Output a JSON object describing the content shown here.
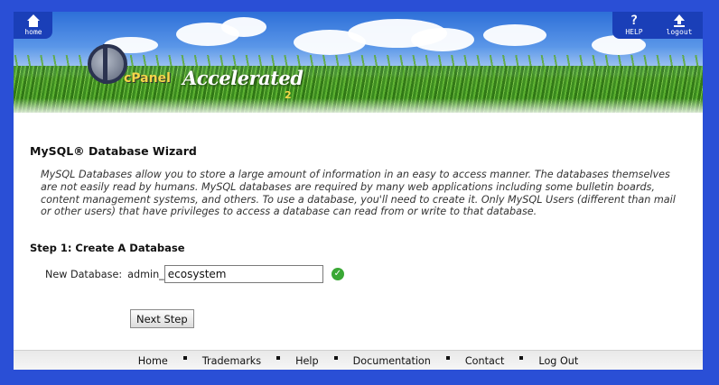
{
  "header": {
    "home_label": "home",
    "help_label": "HELP",
    "logout_label": "logout",
    "logo_text": "cPanel",
    "logo_accent": "Accelerated",
    "logo_version": "2"
  },
  "page": {
    "title": "MySQL® Database Wizard",
    "description": "MySQL Databases allow you to store a large amount of information in an easy to access manner. The databases themselves are not easily read by humans. MySQL databases are required by many web applications including some bulletin boards, content management systems, and others. To use a database, you'll need to create it. Only MySQL Users (different than mail or other users) that have privileges to access a database can read from or write to that database.",
    "step_title": "Step 1: Create A Database"
  },
  "form": {
    "label": "New Database:",
    "prefix": "admin_",
    "value": "ecosystem",
    "next_label": "Next Step"
  },
  "footer": {
    "links": [
      "Home",
      "Trademarks",
      "Help",
      "Documentation",
      "Contact",
      "Log Out"
    ]
  },
  "colors": {
    "frame": "#2a4fd6",
    "valid": "#3aa835"
  },
  "icons": {
    "home": "home-icon",
    "help": "help-icon",
    "logout": "logout-icon",
    "valid": "check-icon"
  }
}
